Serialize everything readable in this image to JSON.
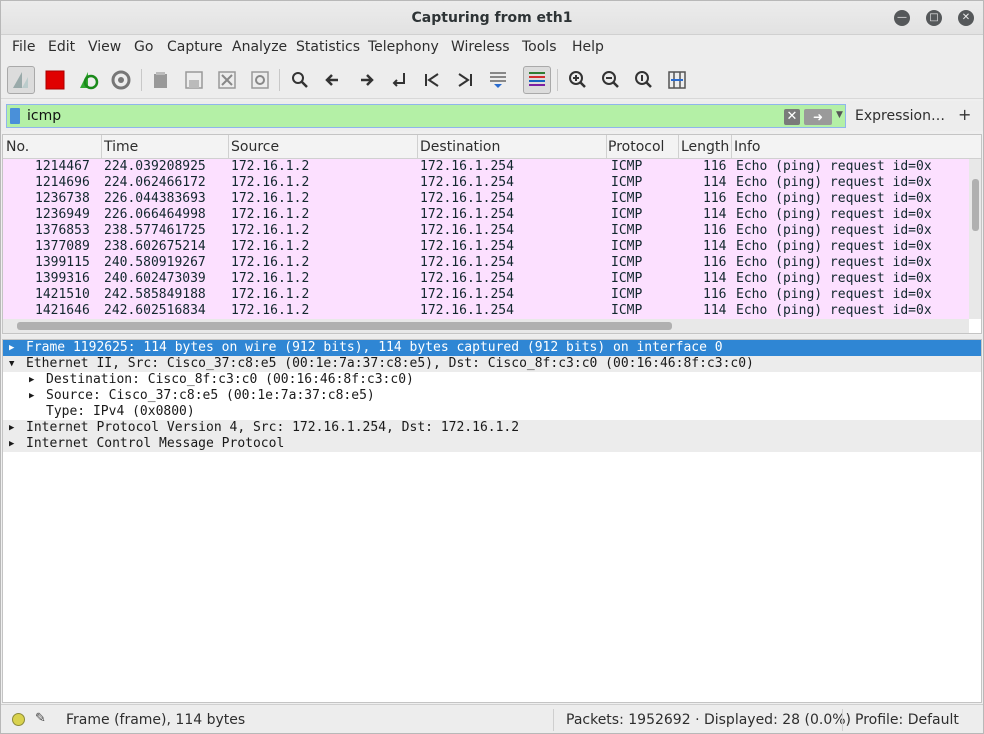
{
  "window": {
    "title": "Capturing from eth1"
  },
  "menu": [
    "File",
    "Edit",
    "View",
    "Go",
    "Capture",
    "Analyze",
    "Statistics",
    "Telephony",
    "Wireless",
    "Tools",
    "Help"
  ],
  "filter": {
    "value": "icmp",
    "expression_label": "Expression…",
    "plus_label": "+"
  },
  "columns": [
    "No.",
    "Time",
    "Source",
    "Destination",
    "Protocol",
    "Length",
    "Info"
  ],
  "packets": [
    {
      "no": "1214467",
      "time": "224.039208925",
      "src": "172.16.1.2",
      "dst": "172.16.1.254",
      "proto": "ICMP",
      "len": "116",
      "info": "Echo (ping) request  id=0x"
    },
    {
      "no": "1214696",
      "time": "224.062466172",
      "src": "172.16.1.2",
      "dst": "172.16.1.254",
      "proto": "ICMP",
      "len": "114",
      "info": "Echo (ping) request  id=0x"
    },
    {
      "no": "1236738",
      "time": "226.044383693",
      "src": "172.16.1.2",
      "dst": "172.16.1.254",
      "proto": "ICMP",
      "len": "116",
      "info": "Echo (ping) request  id=0x"
    },
    {
      "no": "1236949",
      "time": "226.066464998",
      "src": "172.16.1.2",
      "dst": "172.16.1.254",
      "proto": "ICMP",
      "len": "114",
      "info": "Echo (ping) request  id=0x"
    },
    {
      "no": "1376853",
      "time": "238.577461725",
      "src": "172.16.1.2",
      "dst": "172.16.1.254",
      "proto": "ICMP",
      "len": "116",
      "info": "Echo (ping) request  id=0x"
    },
    {
      "no": "1377089",
      "time": "238.602675214",
      "src": "172.16.1.2",
      "dst": "172.16.1.254",
      "proto": "ICMP",
      "len": "114",
      "info": "Echo (ping) request  id=0x"
    },
    {
      "no": "1399115",
      "time": "240.580919267",
      "src": "172.16.1.2",
      "dst": "172.16.1.254",
      "proto": "ICMP",
      "len": "116",
      "info": "Echo (ping) request  id=0x"
    },
    {
      "no": "1399316",
      "time": "240.602473039",
      "src": "172.16.1.2",
      "dst": "172.16.1.254",
      "proto": "ICMP",
      "len": "114",
      "info": "Echo (ping) request  id=0x"
    },
    {
      "no": "1421510",
      "time": "242.585849188",
      "src": "172.16.1.2",
      "dst": "172.16.1.254",
      "proto": "ICMP",
      "len": "116",
      "info": "Echo (ping) request  id=0x"
    },
    {
      "no": "1421646",
      "time": "242.602516834",
      "src": "172.16.1.2",
      "dst": "172.16.1.254",
      "proto": "ICMP",
      "len": "114",
      "info": "Echo (ping) request  id=0x"
    }
  ],
  "details": [
    {
      "text": "Frame 1192625: 114 bytes on wire (912 bits), 114 bytes captured (912 bits) on interface 0",
      "expander": "▶",
      "style": "sel",
      "indent": 0
    },
    {
      "text": "Ethernet II, Src: Cisco_37:c8:e5 (00:1e:7a:37:c8:e5), Dst: Cisco_8f:c3:c0 (00:16:46:8f:c3:c0)",
      "expander": "▼",
      "style": "grey",
      "indent": 0
    },
    {
      "text": "Destination: Cisco_8f:c3:c0 (00:16:46:8f:c3:c0)",
      "expander": "▶",
      "style": "",
      "indent": 1
    },
    {
      "text": "Source: Cisco_37:c8:e5 (00:1e:7a:37:c8:e5)",
      "expander": "▶",
      "style": "",
      "indent": 1
    },
    {
      "text": "Type: IPv4 (0x0800)",
      "expander": "",
      "style": "",
      "indent": 1
    },
    {
      "text": "Internet Protocol Version 4, Src: 172.16.1.254, Dst: 172.16.1.2",
      "expander": "▶",
      "style": "grey",
      "indent": 0
    },
    {
      "text": "Internet Control Message Protocol",
      "expander": "▶",
      "style": "grey",
      "indent": 0
    }
  ],
  "status": {
    "frame_info": "Frame (frame), 114 bytes",
    "packets": "Packets: 1952692 · Displayed: 28 (0.0%)",
    "profile": "Profile: Default"
  },
  "colors": {
    "row_bg": "#fce0ff",
    "selected_bg": "#2f86d4",
    "filter_ok_bg": "#b4f0a6"
  },
  "icons": {
    "window": [
      "minimize-icon",
      "maximize-icon",
      "close-icon"
    ],
    "toolbar": [
      "shark-fin-start-icon",
      "stop-capture-icon",
      "restart-capture-icon",
      "capture-options-icon",
      "open-file-icon",
      "save-file-icon",
      "close-file-icon",
      "reload-file-icon",
      "find-packet-icon",
      "go-back-icon",
      "go-forward-icon",
      "go-to-packet-icon",
      "go-first-packet-icon",
      "go-last-packet-icon",
      "autoscroll-icon",
      "colorize-icon",
      "zoom-in-icon",
      "zoom-out-icon",
      "normal-size-icon",
      "resize-columns-icon"
    ]
  }
}
